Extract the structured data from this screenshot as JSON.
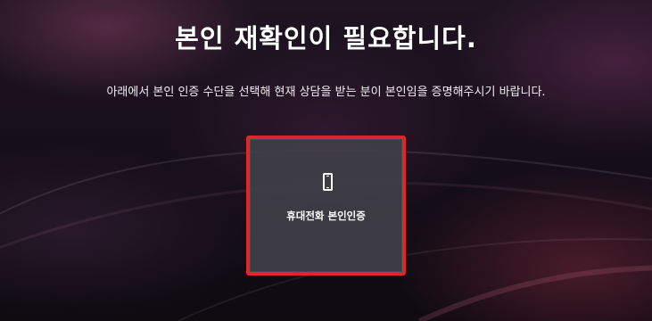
{
  "header": {
    "title": "본인 재확인이 필요합니다.",
    "description": "아래에서 본인 인증 수단을 선택해 현재 상담을 받는 분이 본인임을 증명해주시기 바랍니다."
  },
  "auth_options": [
    {
      "label": "휴대전화 본인인증",
      "icon": "mobile-phone-icon",
      "selected": true,
      "highlight_color": "#e0262a"
    }
  ],
  "colors": {
    "background": "#160f1a",
    "card_background": "#403e46",
    "text": "#ffffff",
    "selection_border": "#e0262a"
  }
}
